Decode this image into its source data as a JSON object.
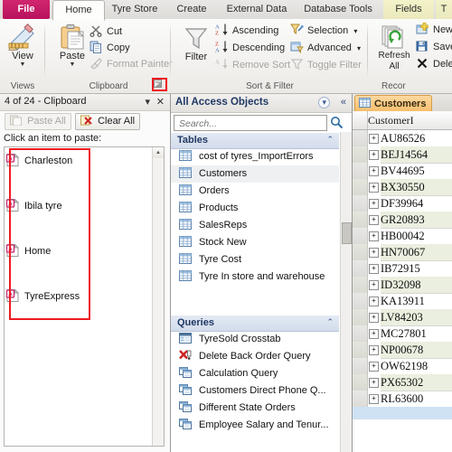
{
  "ribbon": {
    "tabs": [
      {
        "label": "File",
        "type": "file"
      },
      {
        "label": "Home",
        "type": "active"
      },
      {
        "label": "Tyre Store",
        "type": "normal"
      },
      {
        "label": "Create",
        "type": "normal"
      },
      {
        "label": "External Data",
        "type": "normal"
      },
      {
        "label": "Database Tools",
        "type": "normal"
      },
      {
        "label": "Fields",
        "type": "context"
      },
      {
        "label": "T",
        "type": "context"
      }
    ],
    "groups": {
      "views": {
        "label": "Views",
        "view_button": "View",
        "view_arrow": "▼"
      },
      "clipboard": {
        "label": "Clipboard",
        "paste_button": "Paste",
        "paste_arrow": "▼",
        "cut": "Cut",
        "copy": "Copy",
        "format_painter": "Format Painter",
        "launcher_name": "clipboard-dialog-launcher"
      },
      "sortfilter": {
        "label": "Sort & Filter",
        "filter_button": "Filter",
        "ascending": "Ascending",
        "descending": "Descending",
        "remove_sort": "Remove Sort",
        "selection": "Selection",
        "advanced": "Advanced",
        "toggle_filter": "Toggle Filter",
        "dropdown_arrow": "▾"
      },
      "records": {
        "label": "Recor",
        "refresh_all": "Refresh",
        "refresh_all_2": "All",
        "refresh_arrow": "▾",
        "new": "New",
        "save": "Save",
        "delete": "Delete"
      }
    }
  },
  "clipboard_pane": {
    "title": "4 of 24 - Clipboard",
    "dropdown_glyph": "▾",
    "close_glyph": "✕",
    "paste_all": "Paste All",
    "clear_all": "Clear All",
    "hint": "Click an item to paste:",
    "items": [
      {
        "label": "Charleston"
      },
      {
        "label": "Ibila tyre"
      },
      {
        "label": "Home"
      },
      {
        "label": "TyreExpress"
      }
    ],
    "scroll_up_glyph": "▲"
  },
  "nav_pane": {
    "title": "All Access Objects",
    "dropdown_glyph": "▾",
    "collapse_glyph": "«",
    "search_placeholder": "Search...",
    "search_value": "",
    "search_icon": "search-icon",
    "groups": [
      {
        "title": "Tables",
        "collapse_glyph": "⌃",
        "items": [
          {
            "label": "cost of tyres_ImportErrors",
            "icon": "table-icon",
            "selected": false
          },
          {
            "label": "Customers",
            "icon": "table-icon",
            "selected": true
          },
          {
            "label": "Orders",
            "icon": "table-icon",
            "selected": false
          },
          {
            "label": "Products",
            "icon": "table-icon",
            "selected": false
          },
          {
            "label": "SalesReps",
            "icon": "table-icon",
            "selected": false
          },
          {
            "label": "Stock New",
            "icon": "table-icon",
            "selected": false
          },
          {
            "label": "Tyre Cost",
            "icon": "table-icon",
            "selected": false
          },
          {
            "label": "Tyre In store and warehouse",
            "icon": "table-icon",
            "selected": false
          }
        ]
      },
      {
        "title": "Queries",
        "collapse_glyph": "⌃",
        "items": [
          {
            "label": "TyreSold Crosstab",
            "icon": "crosstab-query-icon",
            "selected": false
          },
          {
            "label": "Delete Back Order Query",
            "icon": "delete-query-icon",
            "selected": false
          },
          {
            "label": "Calculation Query",
            "icon": "query-icon",
            "selected": false
          },
          {
            "label": "Customers Direct Phone Q...",
            "icon": "query-icon",
            "selected": false
          },
          {
            "label": "Different State Orders",
            "icon": "query-icon",
            "selected": false
          },
          {
            "label": "Employee Salary and Tenur...",
            "icon": "query-icon",
            "selected": false
          }
        ]
      }
    ]
  },
  "datasheet": {
    "doc_tab": "Customers",
    "doc_tab_icon": "table-icon",
    "column_header": "CustomerI",
    "expand_glyph": "+",
    "rows": [
      {
        "value": "AU86526"
      },
      {
        "value": "BEJ14564"
      },
      {
        "value": "BV44695"
      },
      {
        "value": "BX30550"
      },
      {
        "value": "DF39964"
      },
      {
        "value": "GR20893"
      },
      {
        "value": "HB00042"
      },
      {
        "value": "HN70067"
      },
      {
        "value": "IB72915"
      },
      {
        "value": "ID32098"
      },
      {
        "value": "KA13911"
      },
      {
        "value": "LV84203"
      },
      {
        "value": "MC27801"
      },
      {
        "value": "NP00678"
      },
      {
        "value": "OW62198"
      },
      {
        "value": "PX65302"
      },
      {
        "value": "RL63600"
      }
    ]
  },
  "annotations": {
    "highlight_color": "#ee1b22",
    "boxes": [
      {
        "name": "clipboard-launcher-highlight"
      },
      {
        "name": "clipboard-items-highlight"
      }
    ]
  }
}
